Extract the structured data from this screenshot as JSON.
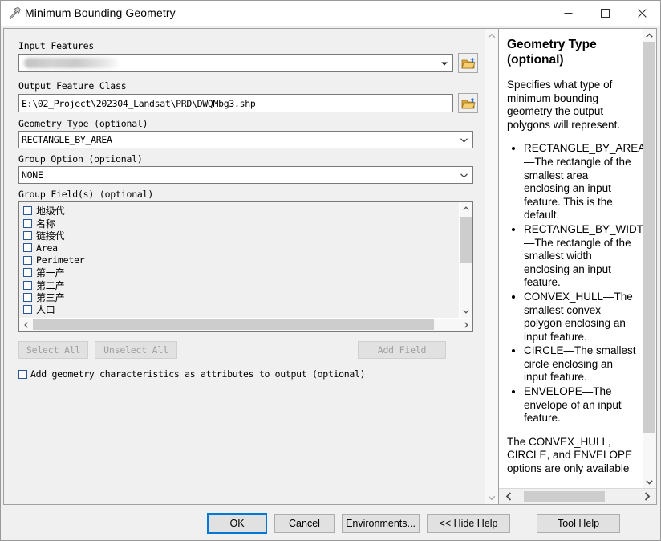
{
  "window": {
    "title": "Minimum Bounding Geometry",
    "icon": "hammer-icon",
    "minimize_label": "—",
    "maximize_label": "□",
    "close_label": "✕"
  },
  "form": {
    "input_features": {
      "label": "Input Features",
      "value": "",
      "redacted": true,
      "browse_label": "open-folder-icon"
    },
    "output_feature_class": {
      "label": "Output Feature Class",
      "value": "E:\\02_Project\\202304_Landsat\\PRD\\DWQMbg3.shp",
      "browse_label": "open-folder-icon"
    },
    "geometry_type": {
      "label": "Geometry Type  (optional)",
      "value": "RECTANGLE_BY_AREA"
    },
    "group_option": {
      "label": "Group Option  (optional)",
      "value": "NONE"
    },
    "group_fields": {
      "label": "Group Field(s)  (optional)",
      "items": [
        {
          "label": "地级代",
          "cjk": true,
          "checked": false
        },
        {
          "label": "名称",
          "cjk": true,
          "checked": false
        },
        {
          "label": "链接代",
          "cjk": true,
          "checked": false
        },
        {
          "label": "Area",
          "cjk": false,
          "checked": false
        },
        {
          "label": "Perimeter",
          "cjk": false,
          "checked": false
        },
        {
          "label": "第一产",
          "cjk": true,
          "checked": false
        },
        {
          "label": "第二产",
          "cjk": true,
          "checked": false
        },
        {
          "label": "第三产",
          "cjk": true,
          "checked": false
        },
        {
          "label": "人口",
          "cjk": true,
          "checked": false
        },
        {
          "label": "",
          "cjk": false,
          "checked": false
        }
      ]
    },
    "select_all_label": "Select All",
    "unselect_all_label": "Unselect All",
    "add_field_label": "Add Field",
    "add_geometry_checkbox": {
      "label": "Add geometry characteristics as attributes to output  (optional)",
      "checked": false
    }
  },
  "help": {
    "heading": "Geometry Type (optional)",
    "intro": "Specifies what type of minimum bounding geometry the output polygons will represent.",
    "bullets": [
      "RECTANGLE_BY_AREA—The rectangle of the smallest area enclosing an input feature. This is the default.",
      "RECTANGLE_BY_WIDTH—The rectangle of the smallest width enclosing an input feature.",
      "CONVEX_HULL—The smallest convex polygon enclosing an input feature.",
      "CIRCLE—The smallest circle enclosing an input feature.",
      "ENVELOPE—The envelope of an input feature."
    ],
    "outro": "The CONVEX_HULL, CIRCLE, and ENVELOPE options are only available",
    "scroll_left_label": "‹",
    "scroll_right_label": "›"
  },
  "footer": {
    "ok_label": "OK",
    "cancel_label": "Cancel",
    "environments_label": "Environments...",
    "hide_help_label": "<< Hide Help",
    "tool_help_label": "Tool Help"
  },
  "colors": {
    "accent": "#0078d7",
    "dialog_bg": "#f0f0f0",
    "field_bg": "#ffffff",
    "scroll_thumb": "#cdcdcd",
    "disabled_text": "#a0a0a0",
    "folder_icon": "#e8b64a"
  }
}
